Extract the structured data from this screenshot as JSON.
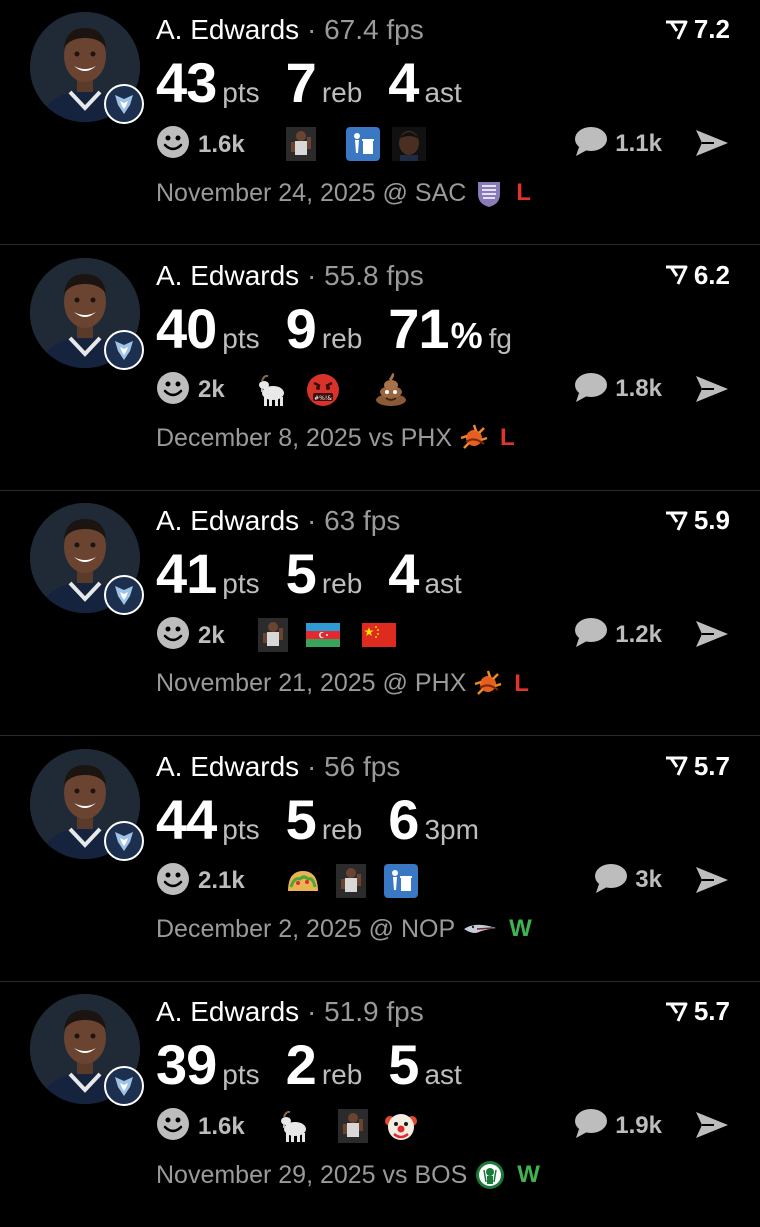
{
  "colors": {
    "loss": "#e0332b",
    "win": "#3fb34f",
    "muted": "#9a9a9a"
  },
  "posts": [
    {
      "player": "A. Edwards",
      "fps": "67.4 fps",
      "rating": "7.2",
      "stats": [
        {
          "value": "43",
          "unit": "pts"
        },
        {
          "value": "7",
          "unit": "reb"
        },
        {
          "value": "4",
          "unit": "ast"
        }
      ],
      "reactions": "1.6k",
      "emojis": [
        "player-photo-icon",
        "trash-can-icon",
        "player-face-icon"
      ],
      "comments": "1.1k",
      "date": "November 24, 2025",
      "venue": "@",
      "opponent": "SAC",
      "opponent_logo": "kings-logo-icon",
      "result": "L"
    },
    {
      "player": "A. Edwards",
      "fps": "55.8 fps",
      "rating": "6.2",
      "stats": [
        {
          "value": "40",
          "unit": "pts"
        },
        {
          "value": "9",
          "unit": "reb"
        },
        {
          "value": "71",
          "unit": "%",
          "unit2": "fg"
        }
      ],
      "reactions": "2k",
      "emojis": [
        "goat-icon",
        "cursing-face-icon",
        "poop-icon"
      ],
      "comments": "1.8k",
      "date": "December 8, 2025",
      "venue": "vs",
      "opponent": "PHX",
      "opponent_logo": "suns-logo-icon",
      "result": "L"
    },
    {
      "player": "A. Edwards",
      "fps": "63 fps",
      "rating": "5.9",
      "stats": [
        {
          "value": "41",
          "unit": "pts"
        },
        {
          "value": "5",
          "unit": "reb"
        },
        {
          "value": "4",
          "unit": "ast"
        }
      ],
      "reactions": "2k",
      "emojis": [
        "player-photo-icon",
        "azerbaijan-flag-icon",
        "china-flag-icon"
      ],
      "comments": "1.2k",
      "date": "November 21, 2025",
      "venue": "@",
      "opponent": "PHX",
      "opponent_logo": "suns-logo-icon",
      "result": "L"
    },
    {
      "player": "A. Edwards",
      "fps": "56 fps",
      "rating": "5.7",
      "stats": [
        {
          "value": "44",
          "unit": "pts"
        },
        {
          "value": "5",
          "unit": "reb"
        },
        {
          "value": "6",
          "unit": "3pm"
        }
      ],
      "reactions": "2.1k",
      "emojis": [
        "taco-icon",
        "player-photo-icon",
        "trash-can-icon"
      ],
      "comments": "3k",
      "date": "December 2, 2025",
      "venue": "@",
      "opponent": "NOP",
      "opponent_logo": "pelicans-logo-icon",
      "result": "W"
    },
    {
      "player": "A. Edwards",
      "fps": "51.9 fps",
      "rating": "5.7",
      "stats": [
        {
          "value": "39",
          "unit": "pts"
        },
        {
          "value": "2",
          "unit": "reb"
        },
        {
          "value": "5",
          "unit": "ast"
        }
      ],
      "reactions": "1.6k",
      "emojis": [
        "goat-icon",
        "player-photo-icon",
        "clown-face-icon"
      ],
      "comments": "1.9k",
      "date": "November 29, 2025",
      "venue": "vs",
      "opponent": "BOS",
      "opponent_logo": "celtics-logo-icon",
      "result": "W"
    }
  ]
}
